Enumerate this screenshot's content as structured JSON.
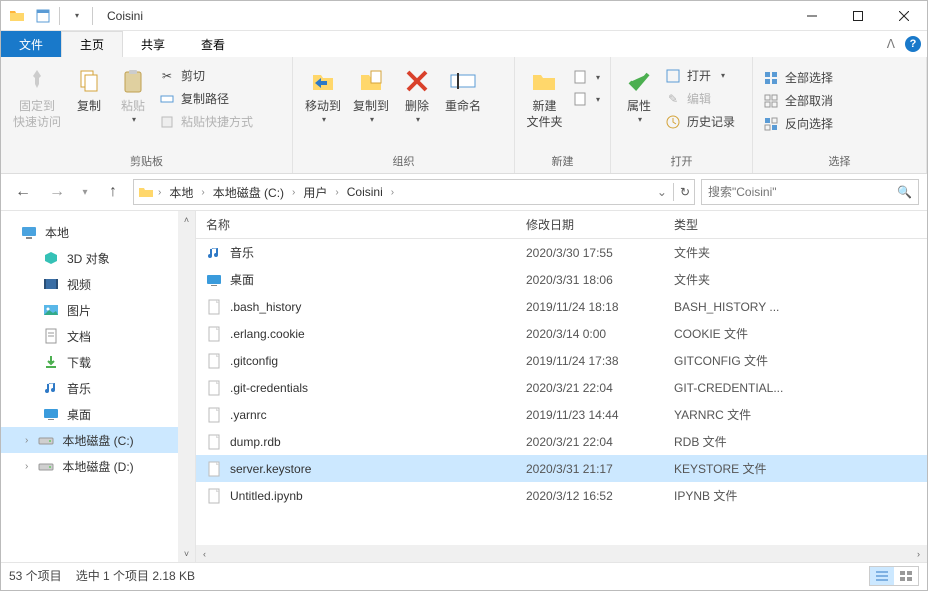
{
  "title": "Coisini",
  "tabs": {
    "file": "文件",
    "home": "主页",
    "share": "共享",
    "view": "查看"
  },
  "ribbon": {
    "clipboard": {
      "label": "剪贴板",
      "pin": "固定到\n快速访问",
      "copy": "复制",
      "paste": "粘贴",
      "cut": "剪切",
      "copypath": "复制路径",
      "pasteshortcut": "粘贴快捷方式"
    },
    "organize": {
      "label": "组织",
      "moveto": "移动到",
      "copyto": "复制到",
      "delete": "删除",
      "rename": "重命名"
    },
    "new": {
      "label": "新建",
      "newfolder": "新建\n文件夹"
    },
    "open": {
      "label": "打开",
      "properties": "属性",
      "open": "打开",
      "edit": "编辑",
      "history": "历史记录"
    },
    "select": {
      "label": "选择",
      "selectall": "全部选择",
      "selectnone": "全部取消",
      "invert": "反向选择"
    }
  },
  "breadcrumb": [
    "本地",
    "本地磁盘 (C:)",
    "用户",
    "Coisini"
  ],
  "search_placeholder": "搜索\"Coisini\"",
  "tree": [
    {
      "label": "本地",
      "icon": "pc",
      "indent": false
    },
    {
      "label": "3D 对象",
      "icon": "3d",
      "indent": true
    },
    {
      "label": "视频",
      "icon": "video",
      "indent": true
    },
    {
      "label": "图片",
      "icon": "picture",
      "indent": true
    },
    {
      "label": "文档",
      "icon": "doc",
      "indent": true
    },
    {
      "label": "下载",
      "icon": "download",
      "indent": true
    },
    {
      "label": "音乐",
      "icon": "music",
      "indent": true
    },
    {
      "label": "桌面",
      "icon": "desktop",
      "indent": true
    },
    {
      "label": "本地磁盘 (C:)",
      "icon": "drive",
      "indent": true,
      "selected": true,
      "expand": true
    },
    {
      "label": "本地磁盘 (D:)",
      "icon": "drive",
      "indent": true,
      "expand": true
    }
  ],
  "columns": {
    "name": "名称",
    "date": "修改日期",
    "type": "类型"
  },
  "files": [
    {
      "name": "音乐",
      "date": "2020/3/30 17:55",
      "type": "文件夹",
      "icon": "music"
    },
    {
      "name": "桌面",
      "date": "2020/3/31 18:06",
      "type": "文件夹",
      "icon": "desktop"
    },
    {
      "name": ".bash_history",
      "date": "2019/11/24 18:18",
      "type": "BASH_HISTORY ...",
      "icon": "file"
    },
    {
      "name": ".erlang.cookie",
      "date": "2020/3/14 0:00",
      "type": "COOKIE 文件",
      "icon": "file"
    },
    {
      "name": ".gitconfig",
      "date": "2019/11/24 17:38",
      "type": "GITCONFIG 文件",
      "icon": "file"
    },
    {
      "name": ".git-credentials",
      "date": "2020/3/21 22:04",
      "type": "GIT-CREDENTIAL...",
      "icon": "file"
    },
    {
      "name": ".yarnrc",
      "date": "2019/11/23 14:44",
      "type": "YARNRC 文件",
      "icon": "file"
    },
    {
      "name": "dump.rdb",
      "date": "2020/3/21 22:04",
      "type": "RDB 文件",
      "icon": "file"
    },
    {
      "name": "server.keystore",
      "date": "2020/3/31 21:17",
      "type": "KEYSTORE 文件",
      "icon": "file",
      "selected": true
    },
    {
      "name": "Untitled.ipynb",
      "date": "2020/3/12 16:52",
      "type": "IPYNB 文件",
      "icon": "file"
    }
  ],
  "status": {
    "count": "53 个项目",
    "selection": "选中 1 个项目 2.18 KB"
  }
}
